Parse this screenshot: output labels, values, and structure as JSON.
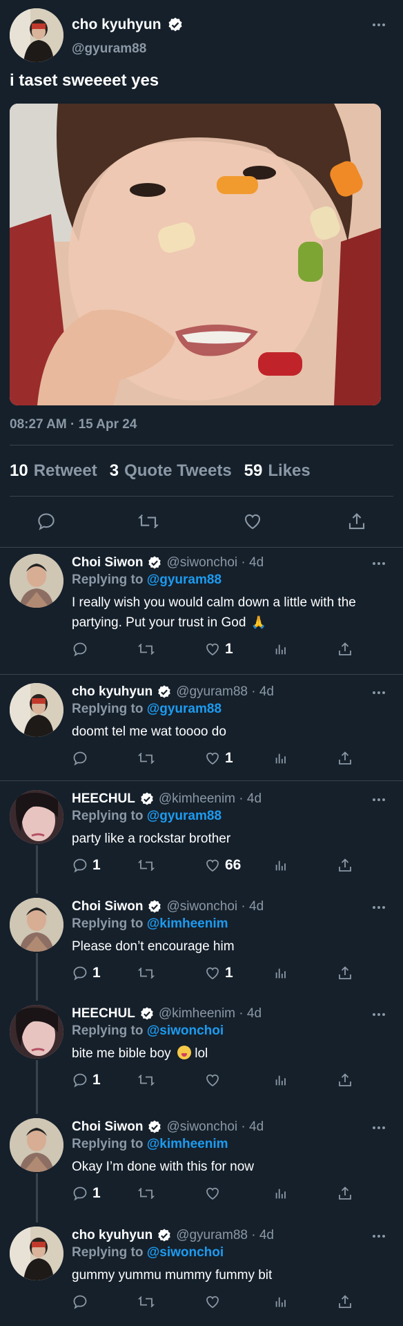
{
  "main": {
    "name": "cho kyuhyun",
    "handle": "@gyuram88",
    "text": "i taset sweeeet yes",
    "time": "08:27 AM · 15 Apr 24",
    "stats": [
      {
        "num": "10",
        "label": "Retweet"
      },
      {
        "num": "3",
        "label": "Quote Tweets"
      },
      {
        "num": "59",
        "label": "Likes"
      }
    ]
  },
  "icons": {
    "verified": "verified-badge-icon",
    "reply": "reply-icon",
    "retweet": "retweet-icon",
    "like": "heart-icon",
    "views": "views-icon",
    "share": "share-icon",
    "more": "more-icon"
  },
  "replies": [
    {
      "name": "Choi Siwon",
      "handle": "@siwonchoi · 4d",
      "replying_label": "Replying to",
      "replying_to": "@gyuram88",
      "text": "I really wish you would calm down a little with the partying. Put your trust in God",
      "reply_count": "",
      "like_count": "1"
    },
    {
      "name": "cho kyuhyun",
      "handle": "@gyuram88 · 4d",
      "replying_label": "Replying to",
      "replying_to": "@gyuram88",
      "text": "doomt tel me wat toooo do",
      "reply_count": "",
      "like_count": "1"
    },
    {
      "name": "HEECHUL",
      "handle": "@kimheenim · 4d",
      "replying_label": "Replying to",
      "replying_to": "@gyuram88",
      "text": "party like a rockstar brother",
      "reply_count": "1",
      "like_count": "66"
    },
    {
      "name": "Choi Siwon",
      "handle": "@siwonchoi · 4d",
      "replying_label": "Replying to",
      "replying_to": "@kimheenim",
      "text": "Please don’t encourage him",
      "reply_count": "1",
      "like_count": "1"
    },
    {
      "name": "HEECHUL",
      "handle": "@kimheenim · 4d",
      "replying_label": "Replying to",
      "replying_to": "@siwonchoi",
      "text": "bite me bible boy",
      "text_after": "lol",
      "reply_count": "1",
      "like_count": ""
    },
    {
      "name": "Choi Siwon",
      "handle": "@siwonchoi · 4d",
      "replying_label": "Replying to",
      "replying_to": "@kimheenim",
      "text": "Okay I’m done with this for now",
      "reply_count": "1",
      "like_count": ""
    },
    {
      "name": "cho kyuhyun",
      "handle": "@gyuram88 · 4d",
      "replying_label": "Replying to",
      "replying_to": "@siwonchoi",
      "text": "gummy yummu mummy fummy bit",
      "reply_count": "",
      "like_count": ""
    }
  ]
}
